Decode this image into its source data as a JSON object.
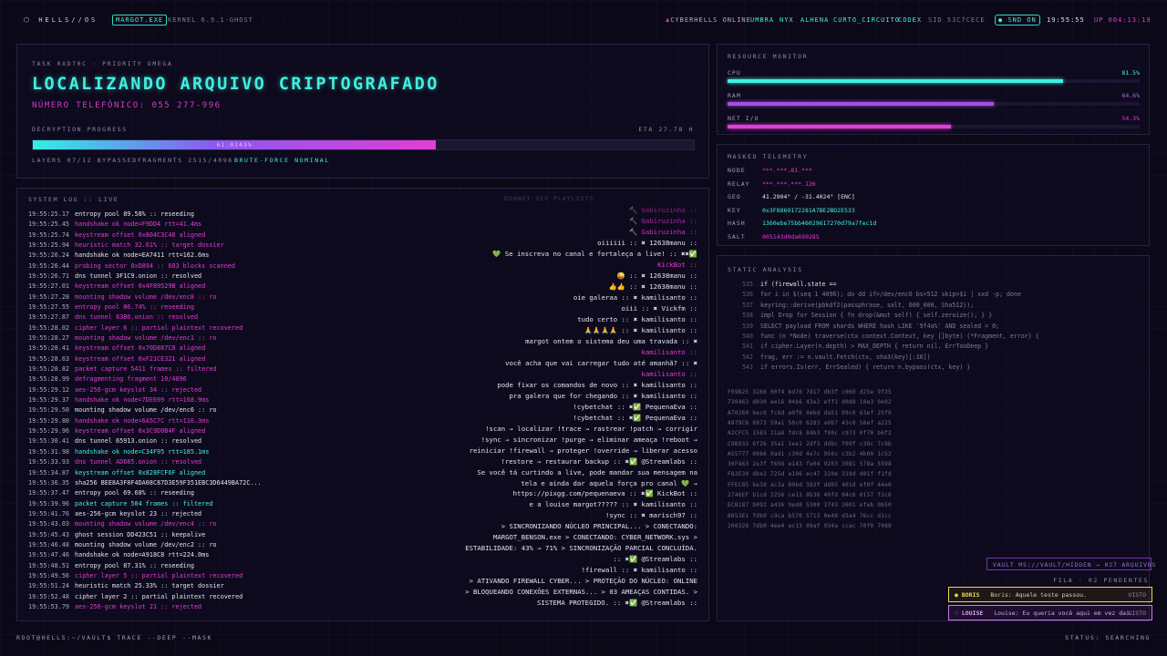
{
  "topbar": {
    "logo": "HELLS//OS",
    "process": "MARGOT.EXE",
    "kernel": "KERNEL 6.9.1-GHOST",
    "online_label": "CYBERHELLS ONLINE",
    "users": [
      "UMBRA",
      "NYX",
      "ALHENA",
      "CURTO_CIRCUITO",
      "CODEX"
    ],
    "sid": "SID 53C7CECE",
    "snd": "SND ON",
    "time": "19:55:55",
    "uptime": "UP 004:13:19"
  },
  "task": {
    "id": "TASK 0XD70C · PRIORITY OMEGA",
    "title": "LOCALIZANDO ARQUIVO CRIPTOGRAFADO",
    "phone": "NÚMERO TELEFÔNICO: 055 277-996",
    "progress_label": "DECRYPTION PROGRESS",
    "eta": "ETA 27.78 H",
    "progress_text": "61.0143%",
    "progress": 0.61,
    "layers": "LAYERS 07/12 BYPASSED",
    "fragments": "FRAGMENTS 2515/4096",
    "status": "BRUTE-FORCE NOMINAL"
  },
  "resources": {
    "title": "RESOURCE MONITOR",
    "items": [
      {
        "name": "CPU",
        "value": "81.5%",
        "level": 0.815,
        "color": "#3ff0e0"
      },
      {
        "name": "RAM",
        "value": "64.6%",
        "level": 0.646,
        "color": "#a24fe0"
      },
      {
        "name": "NET I/O",
        "value": "54.3%",
        "level": 0.543,
        "color": "#e23dd6"
      }
    ]
  },
  "telemetry": {
    "title": "MASKED TELEMETRY",
    "rows": [
      {
        "k": "NODE",
        "v": "***.***.81.***",
        "c": "#e33cd3"
      },
      {
        "k": "RELAY",
        "v": "***.***.***.126",
        "c": "#e33cd3"
      },
      {
        "k": "GEO",
        "v": "41.2904° / -31.4024° [ENC]",
        "c": "#dfe4f0"
      },
      {
        "k": "KEY",
        "v": "0x3F8869172281A7BE2BD2E533",
        "c": "#3ff0e0"
      },
      {
        "k": "HASH",
        "v": "1360ebe75bb46029617270d79a7fec1d",
        "c": "#3ff0e0"
      },
      {
        "k": "SALT",
        "v": "005143d0da699285",
        "c": "#e33cd3"
      }
    ]
  },
  "analysis": {
    "title": "STATIC ANALYSIS",
    "code": [
      {
        "n": "535",
        "t": "if (firewall.state ==",
        "c": "#dfe4f0"
      },
      {
        "n": "536",
        "t": "for i in $(seq 1 4096); do dd if=/dev/enc0 bs=512 skip=$i | xxd -p; done",
        "c": "#7e7a96"
      },
      {
        "n": "537",
        "t": "keyring::derive(pbkdf2(passphrase, salt, 600_000, Sha512));",
        "c": "#7e7a96"
      },
      {
        "n": "538",
        "t": "impl Drop for Session { fn drop(&mut self) { self.zeroize(); } }",
        "c": "#7e7a96"
      },
      {
        "n": "539",
        "t": "SELECT payload FROM shards WHERE hash LIKE '9f4a%' AND sealed = 0;",
        "c": "#7e7a96"
      },
      {
        "n": "540",
        "t": "func (n *Node) traverse(ctx context.Context, key []byte) (*Fragment, error) {",
        "c": "#7e7a96"
      },
      {
        "n": "541",
        "t": "if cipher.Layer(n.depth) > MAX_DEPTH { return nil, ErrTooDeep }",
        "c": "#7e7a96"
      },
      {
        "n": "542",
        "t": "frag, err := n.vault.Fetch(ctx, sha3(key)[:16])",
        "c": "#7e7a96"
      },
      {
        "n": "543",
        "t": "if errors.Is(err, ErrSealed) { return n.bypass(ctx, key) }",
        "c": "#7e7a96"
      }
    ],
    "hex": [
      "F09B25 3266 00f4 bd76 7d17 db3f c060 d25e 9f35",
      "730463 d030 ee16 04b6 43e2 eff1 d0d8 10e3 0e02",
      "A70260 6ec0 fc8d a0f6 0ebd da51 09c0 63ef 25f9",
      "A979C6 8973 59a1 50c0 6283 a0b7 43c0 56ef a225",
      "A2CFC5 1583 21a8 fdc8 84b3 f00c c973 0f70 b6f2",
      "C9B933 6f2b 35a1 1ee1 2df3 ddbc f09f c38c 7c9b",
      "A55777 0066 0ad1 c30d 4e7c 956c c3b2 4b00 1c52",
      "30FA63 2e3f f698 e143 fe04 9203 3081 578a 5598",
      "F82E30 dbe2 725d a196 ec47 320e 319d d01f f1fd",
      "FFEC85 be30 ac3a 80bd 383f dd05 401d ef0f 44e0",
      "2746EF b1cd 2256 ce13 8b36 49fd 04c6 0157 f3c6",
      "ECB187 b092 a436 9ed0 5300 3743 2601 efeb 0b50",
      "B853E1 fdb0 c9ca b570 5713 0e48 d3a4 76cc d1cc",
      "200328 7db0 4ee4 ac13 09af 934a ccac 70f0 7088"
    ]
  },
  "log": {
    "title": "SYSTEM LOG :: LIVE",
    "lines": [
      {
        "ts": "19:55:25.17",
        "m": "entropy pool 89.58% :: reseeding",
        "c": "#dfe4f0"
      },
      {
        "ts": "19:55:25.45",
        "m": "handshake ok node=F9DD4 rtt=41.4ms",
        "c": "#e33cd3"
      },
      {
        "ts": "19:55:25.74",
        "m": "keystream offset 0x804C3C48 aligned",
        "c": "#e33cd3"
      },
      {
        "ts": "19:55:25.94",
        "m": "heuristic match 32.61% :: target dossier",
        "c": "#e33cd3"
      },
      {
        "ts": "19:55:26.24",
        "m": "handshake ok node=EA7411 rtt=162.6ms",
        "c": "#dfe4f0"
      },
      {
        "ts": "19:55:26.44",
        "m": "probing sector 0xD894 :: 683 blocks scanned",
        "c": "#e33cd3"
      },
      {
        "ts": "19:55:26.71",
        "m": "dns tunnel 3F1C9.onion :: resolved",
        "c": "#dfe4f0"
      },
      {
        "ts": "19:55:27.01",
        "m": "keystream offset 0x4F89529B aligned",
        "c": "#e33cd3"
      },
      {
        "ts": "19:55:27.28",
        "m": "mounting shadow volume /dev/enc8 :: ro",
        "c": "#e33cd3"
      },
      {
        "ts": "19:55:27.55",
        "m": "entropy pool 86.74% :: reseeding",
        "c": "#e33cd3"
      },
      {
        "ts": "19:55:27.87",
        "m": "dns tunnel 83B6.onion :: resolved",
        "c": "#e33cd3"
      },
      {
        "ts": "19:55:28.02",
        "m": "cipher layer 6 :: partial plaintext recovered",
        "c": "#e33cd3"
      },
      {
        "ts": "19:55:28.27",
        "m": "mounting shadow volume /dev/enc1 :: ro",
        "c": "#e33cd3"
      },
      {
        "ts": "19:55:28.41",
        "m": "keystream offset 0x70D887C8 aligned",
        "c": "#e33cd3"
      },
      {
        "ts": "19:55:28.63",
        "m": "keystream offset 0xF21CE321 aligned",
        "c": "#e33cd3"
      },
      {
        "ts": "19:55:28.82",
        "m": "packet capture 5411 frames :: filtered",
        "c": "#e33cd3"
      },
      {
        "ts": "19:55:28.99",
        "m": "defragmenting fragment 10/4096",
        "c": "#e33cd3"
      },
      {
        "ts": "19:55:29.12",
        "m": "aes-256-gcm keyslot 34 :: rejected",
        "c": "#e33cd3"
      },
      {
        "ts": "19:55:29.37",
        "m": "handshake ok node=7DE699 rtt=168.9ms",
        "c": "#e33cd3"
      },
      {
        "ts": "19:55:29.50",
        "m": "mounting shadow volume /dev/enc6 :: ro",
        "c": "#dfe4f0"
      },
      {
        "ts": "19:55:29.80",
        "m": "handshake ok node=6A5C7C rtt=116.3ms",
        "c": "#e33cd3"
      },
      {
        "ts": "19:55:29.96",
        "m": "keystream offset 0x3C9D0B4F aligned",
        "c": "#e33cd3"
      },
      {
        "ts": "19:55:30.41",
        "m": "dns tunnel 65913.onion :: resolved",
        "c": "#dfe4f0"
      },
      {
        "ts": "19:55:31.98",
        "m": "handshake ok node=C34F95 rtt=185.1ms",
        "c": "#3ff0e0"
      },
      {
        "ts": "19:55:33.93",
        "m": "dns tunnel AD685.onion :: resolved",
        "c": "#e33cd3"
      },
      {
        "ts": "19:55:34.87",
        "m": "keystream offset 0x828FCF6F aligned",
        "c": "#3ff0e0"
      },
      {
        "ts": "19:55:36.35",
        "m": "sha256 BEE8A3F8F4DA08C87D3E59F351EBC3D6449BA72C...",
        "c": "#dfe4f0"
      },
      {
        "ts": "19:55:37.47",
        "m": "entropy pool 69.68% :: reseeding",
        "c": "#dfe4f0"
      },
      {
        "ts": "19:55:39.96",
        "m": "packet capture 504 frames :: filtered",
        "c": "#3ff0e0"
      },
      {
        "ts": "19:55:41.76",
        "m": "aes-256-gcm keyslot 23 :: rejected",
        "c": "#dfe4f0"
      },
      {
        "ts": "19:55:43.03",
        "m": "mounting shadow volume /dev/enc4 :: ro",
        "c": "#e33cd3"
      },
      {
        "ts": "19:55:45.43",
        "m": "ghost session DD423C51 :: keepalive",
        "c": "#dfe4f0"
      },
      {
        "ts": "19:55:46.48",
        "m": "mounting shadow volume /dev/enc2 :: ro",
        "c": "#dfe4f0"
      },
      {
        "ts": "19:55:47.46",
        "m": "handshake ok node=A918C8 rtt=224.0ms",
        "c": "#dfe4f0"
      },
      {
        "ts": "19:55:48.51",
        "m": "entropy pool 87.31% :: reseeding",
        "c": "#dfe4f0"
      },
      {
        "ts": "19:55:49.56",
        "m": "cipher layer 5 :: partial plaintext recovered",
        "c": "#e33cd3"
      },
      {
        "ts": "19:55:51.24",
        "m": "heuristic match 25.33% :: target dossier",
        "c": "#dfe4f0"
      },
      {
        "ts": "19:55:52.48",
        "m": "cipher layer 2 :: partial plaintext recovered",
        "c": "#dfe4f0"
      },
      {
        "ts": "19:55:53.79",
        "m": "aes-256-gcm keyslot 21 :: rejected",
        "c": "#e33cd3"
      }
    ]
  },
  "chat": {
    "header": "DOWNEI SEU PLAYLISTS",
    "lines": [
      {
        "t": "🔨 Gabiruzinha ::",
        "c": "#e33cd3",
        "o": 0.55
      },
      {
        "t": "🔨 Gabiruzinha ::",
        "c": "#e33cd3",
        "o": 0.7
      },
      {
        "t": "🔨 Gabiruzinha ::",
        "c": "#e33cd3",
        "o": 0.85
      },
      {
        "t": "oiiiiii :: ✖ 12638manu ::",
        "c": "#dfe4f0",
        "o": 1
      },
      {
        "t": "💚 Se inscreva no canal e fortaleça a live! :: ✖✖✅",
        "c": "#dfe4f0",
        "o": 1
      },
      {
        "t": "KickBot ::",
        "c": "#e33cd3",
        "o": 1
      },
      {
        "t": "😜 :: ✖ 12638manu ::",
        "c": "#dfe4f0",
        "o": 1
      },
      {
        "t": "👍👍 :: ✖ 12638manu ::",
        "c": "#dfe4f0",
        "o": 1
      },
      {
        "t": "oie galeraa :: ✖ kamilisanto ::",
        "c": "#dfe4f0",
        "o": 1
      },
      {
        "t": "oiii :: ✖ Vickfm ::",
        "c": "#dfe4f0",
        "o": 1
      },
      {
        "t": "tudo certo :: ✖ kamilisanto ::",
        "c": "#dfe4f0",
        "o": 1
      },
      {
        "t": "🙏🙏🙏🙏 :: ✖ kamilisanto ::",
        "c": "#dfe4f0",
        "o": 1
      },
      {
        "t": "margot ontem o sistema deu uma travada :: ✖",
        "c": "#dfe4f0",
        "o": 1
      },
      {
        "t": "kamilisanto ::",
        "c": "#e33cd3",
        "o": 1
      },
      {
        "t": "você acha que vai carregar tudo até amanhã? :: ✖",
        "c": "#dfe4f0",
        "o": 1
      },
      {
        "t": "kamilisanto ::",
        "c": "#e33cd3",
        "o": 1
      },
      {
        "t": "pode fixar os comandos de novo :: ✖ kamilisanto ::",
        "c": "#dfe4f0",
        "o": 1
      },
      {
        "t": "pra galera que for chegando :: ✖ kamilisanto ::",
        "c": "#dfe4f0",
        "o": 1
      },
      {
        "t": "!cybetchat :: ✖✅ PequenaEva ::",
        "c": "#dfe4f0",
        "o": 1
      },
      {
        "t": "!cybetchat :: ✖✅ PequenaEva ::",
        "c": "#dfe4f0",
        "o": 1
      },
      {
        "t": "!scan → localizar !trace → rastrear !patch → corrigir",
        "c": "#dfe4f0",
        "o": 1
      },
      {
        "t": "!sync → sincronizar !purge → eliminar ameaça !reboot →",
        "c": "#dfe4f0",
        "o": 1
      },
      {
        "t": "reiniciar !firewall → proteger !override → liberar acesso",
        "c": "#dfe4f0",
        "o": 1
      },
      {
        "t": "!restore → restaurar backup :: ✖✅ @Streamlabs ::",
        "c": "#dfe4f0",
        "o": 1
      },
      {
        "t": "Se você tá curtindo a live, pode mandar sua mensagem na",
        "c": "#dfe4f0",
        "o": 1
      },
      {
        "t": "tela e ainda dar aquela força pro canal 💚 →",
        "c": "#dfe4f0",
        "o": 1
      },
      {
        "t": "https://pixgg.com/pequenaeva :: ✖✅ KickBot ::",
        "c": "#dfe4f0",
        "o": 1
      },
      {
        "t": "e a louise margot????? :: ✖ kamilisanto ::",
        "c": "#dfe4f0",
        "o": 1
      },
      {
        "t": "!sync :: ✖ marisch97 ::",
        "c": "#dfe4f0",
        "o": 1
      },
      {
        "t": "> SINCRONIZANDO NÚCLEO PRINCIPAL... > CONECTANDO:",
        "c": "#dfe4f0",
        "o": 1
      },
      {
        "t": "MARGOT_BENSON.exe > CONECTANDO: CYBER_NETWORK.sys >",
        "c": "#dfe4f0",
        "o": 1
      },
      {
        "t": "ESTABILIDADE: 43% → 71% > SINCRONIZAÇÃO PARCIAL CONCLUÍDA.",
        "c": "#dfe4f0",
        "o": 1
      },
      {
        "t": ":: ✖✅ @Streamlabs ::",
        "c": "#dfe4f0",
        "o": 1
      },
      {
        "t": "!firewall :: ✖ kamilisanto ::",
        "c": "#dfe4f0",
        "o": 1
      },
      {
        "t": "> ATIVANDO FIREWALL CYBER... > PROTEÇÃO DO NÚCLEO: ONLINE",
        "c": "#dfe4f0",
        "o": 1
      },
      {
        "t": "> BLOQUEANDO CONEXÕES EXTERNAS... > 03 AMEAÇAS CONTIDAS. >",
        "c": "#dfe4f0",
        "o": 1
      },
      {
        "t": "SISTEMA PROTEGIDO. :: ✖✅ @Streamlabs ::",
        "c": "#dfe4f0",
        "o": 1
      }
    ]
  },
  "vault": {
    "label": "VAULT MS://VAULT/HIDDEN → 027 ARQUIVOS",
    "queue": "FILA · 02 PENDENTES"
  },
  "messages": [
    {
      "name": "BORIS",
      "text": "Boris: Aquele teste passou.",
      "status": "VISTO",
      "color": "#e8d84a"
    },
    {
      "name": "LOUISE",
      "text": "Louise: Eu queria você aqui em vez dai.",
      "status": "VISTO",
      "color": "#c57af0"
    }
  ],
  "bottom": {
    "prompt": "ROOT@HELLS:~/VAULT$ TRACE --DEEP --MASK",
    "status": "STATUS: SEARCHING"
  }
}
